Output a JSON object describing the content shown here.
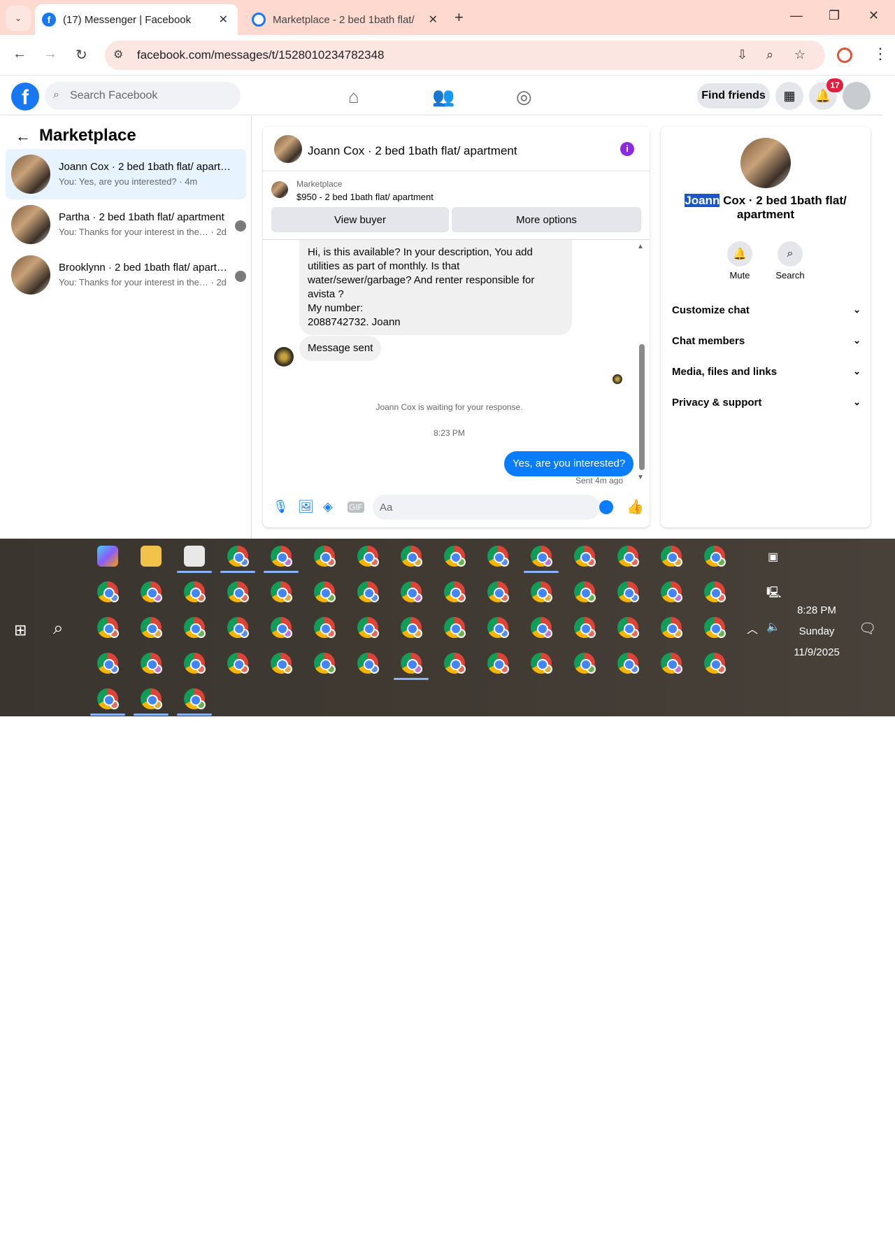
{
  "browser": {
    "tabs": [
      {
        "label": "(17) Messenger | Facebook",
        "favicon": "facebook-icon"
      },
      {
        "label": "Marketplace - 2 bed 1bath flat/",
        "favicon": "messenger-icon"
      }
    ],
    "url": "facebook.com/messages/t/1528010234782348",
    "accent": "#fdd9d0"
  },
  "fb": {
    "search_placeholder": "Search Facebook",
    "find_friends": "Find friends",
    "notif_count": "17"
  },
  "left": {
    "title": "Marketplace",
    "conversations": [
      {
        "name": "Joann Cox · 2 bed 1bath flat/ apartment",
        "preview": "You: Yes, are you interested? · 4m",
        "selected": true
      },
      {
        "name": "Partha · 2 bed 1bath flat/ apartment",
        "preview": "You: Thanks for your interest in the… · 2d"
      },
      {
        "name": "Brooklynn · 2 bed 1bath flat/ apartment",
        "preview": "You: Thanks for your interest in the… · 2d"
      }
    ]
  },
  "chat": {
    "title": "Joann Cox · 2 bed 1bath flat/ apartment",
    "marketplace_label": "Marketplace",
    "listing": "$950 - 2 bed 1bath flat/ apartment",
    "view_buyer": "View buyer",
    "more_options": "More options",
    "incoming_1": "Hi, is this available? In your description, You add utilities as part of monthly. Is that water/sewer/garbage? And renter responsible for avista ?\nMy number:\n2088742732. Joann",
    "incoming_2": "Message sent",
    "waiting": "Joann Cox is waiting for your response.",
    "timestamp": "8:23 PM",
    "outgoing": "Yes, are you interested?",
    "sent_status": "Sent 4m ago",
    "composer_placeholder": "Aa",
    "accent": "#0a7cff"
  },
  "right": {
    "name_highlight": "Joann",
    "name_rest": " Cox · 2 bed 1bath flat/ apartment",
    "mute": "Mute",
    "search": "Search",
    "sections": [
      "Customize chat",
      "Chat members",
      "Media, files and links",
      "Privacy & support"
    ]
  },
  "taskbar": {
    "time": "8:28 PM",
    "day": "Sunday",
    "date": "11/9/2025"
  }
}
